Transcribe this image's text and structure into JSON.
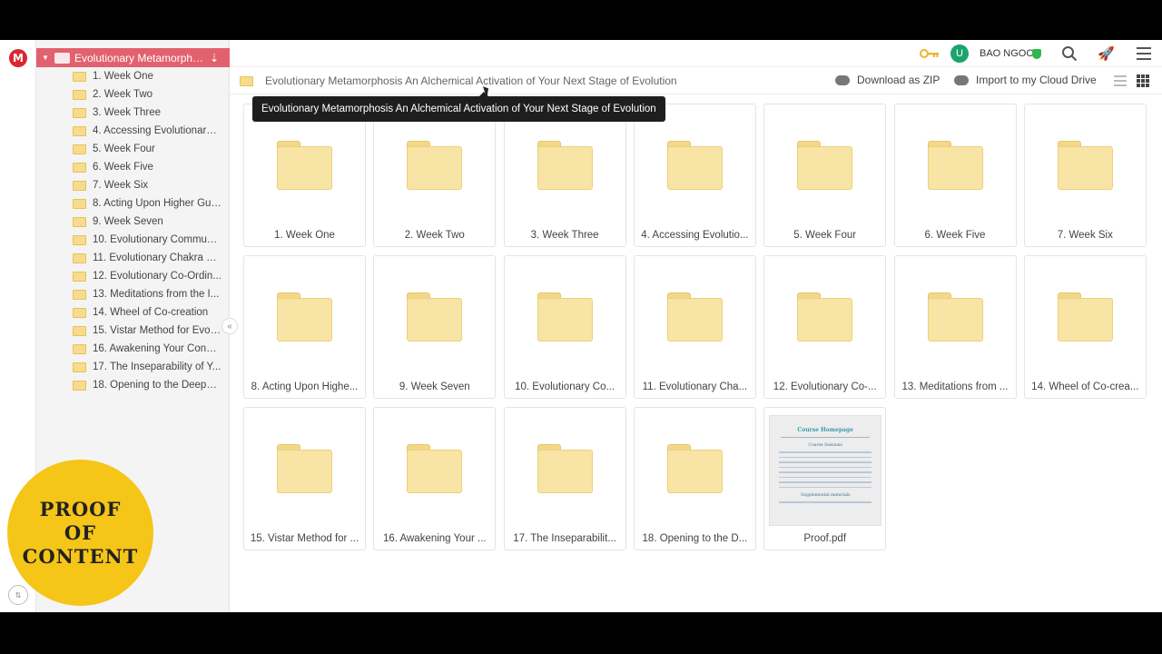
{
  "rail": {
    "logo": "M",
    "transfer_icon": "transfer-icon"
  },
  "sidebar": {
    "root_label": "Evolutionary Metamorphos...",
    "items": [
      "1. Week One",
      "2. Week Two",
      "3. Week Three",
      "4. Accessing Evolutionary ...",
      "5. Week Four",
      "6. Week Five",
      "7. Week Six",
      "8. Acting Upon Higher Gui...",
      "9. Week Seven",
      "10. Evolutionary Communi...",
      "11. Evolutionary Chakra M...",
      "12. Evolutionary Co-Ordin...",
      "13. Meditations from the I...",
      "14. Wheel of Co-creation",
      "15. Vistar Method for Evolu...",
      "16. Awakening Your Consci...",
      "17. The Inseparability of Y...",
      "18. Opening to the Deeper ..."
    ]
  },
  "topbar": {
    "avatar_letter": "U",
    "user_name": "BAO NGOC"
  },
  "pathbar": {
    "path": "Evolutionary Metamorphosis An Alchemical Activation of Your Next Stage of Evolution",
    "download_zip": "Download as ZIP",
    "import_drive": "Import to my Cloud Drive"
  },
  "tooltip": "Evolutionary Metamorphosis An Alchemical Activation of Your Next Stage of Evolution",
  "badge": "PROOF\nOF\nCONTENT",
  "grid": {
    "items": [
      {
        "name": "1. Week One",
        "type": "folder"
      },
      {
        "name": "2. Week Two",
        "type": "folder"
      },
      {
        "name": "3. Week Three",
        "type": "folder"
      },
      {
        "name": "4. Accessing Evolutio...",
        "type": "folder"
      },
      {
        "name": "5. Week Four",
        "type": "folder"
      },
      {
        "name": "6. Week Five",
        "type": "folder"
      },
      {
        "name": "7. Week Six",
        "type": "folder"
      },
      {
        "name": "8. Acting Upon Highe...",
        "type": "folder"
      },
      {
        "name": "9. Week Seven",
        "type": "folder"
      },
      {
        "name": "10. Evolutionary Co...",
        "type": "folder"
      },
      {
        "name": "11. Evolutionary Cha...",
        "type": "folder"
      },
      {
        "name": "12. Evolutionary Co-...",
        "type": "folder"
      },
      {
        "name": "13. Meditations from ...",
        "type": "folder"
      },
      {
        "name": "14. Wheel of Co-crea...",
        "type": "folder"
      },
      {
        "name": "15. Vistar Method for ...",
        "type": "folder"
      },
      {
        "name": "16. Awakening Your ...",
        "type": "folder"
      },
      {
        "name": "17. The Inseparabilit...",
        "type": "folder"
      },
      {
        "name": "18. Opening to the D...",
        "type": "folder"
      },
      {
        "name": "Proof.pdf",
        "type": "pdf",
        "thumb_title": "Course Homepage",
        "thumb_heading": "Course Sessions",
        "thumb_heading2": "Supplemental materials"
      }
    ]
  },
  "colors": {
    "accent": "#e2616e",
    "folder": "#f8e4a4",
    "badge": "#f5c518"
  }
}
